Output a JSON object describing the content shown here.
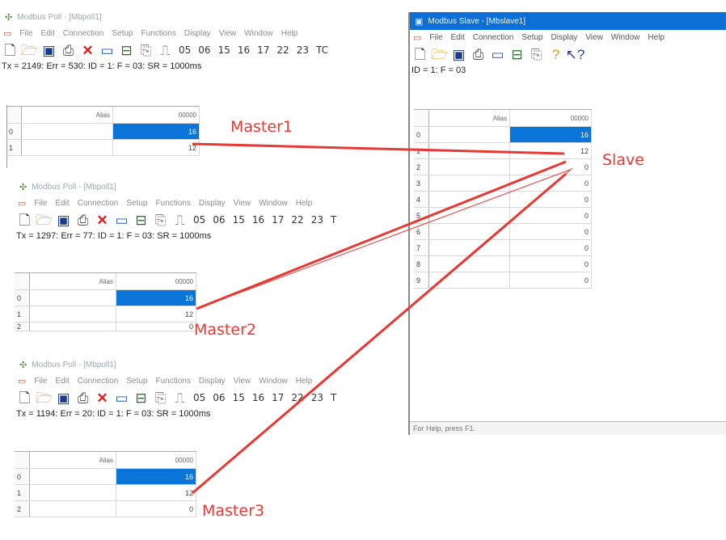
{
  "master1": {
    "title": "Modbus Poll - [Mbpoll1]",
    "menu": [
      "File",
      "Edit",
      "Connection",
      "Setup",
      "Functions",
      "Display",
      "View",
      "Window",
      "Help"
    ],
    "function_buttons": [
      "05",
      "06",
      "15",
      "16",
      "17",
      "22",
      "23",
      "TC"
    ],
    "status": "Tx = 2149: Err = 530: ID = 1: F = 03: SR = 1000ms",
    "grid": {
      "alias_header": "Alias",
      "value_header": "00000",
      "rows": [
        {
          "index": "0",
          "value": "16"
        },
        {
          "index": "1",
          "value": "12"
        }
      ]
    }
  },
  "master2": {
    "title": "Modbus Poll - [Mbpoll1]",
    "menu": [
      "File",
      "Edit",
      "Connection",
      "Setup",
      "Functions",
      "Display",
      "View",
      "Window",
      "Help"
    ],
    "function_buttons": [
      "05",
      "06",
      "15",
      "16",
      "17",
      "22",
      "23",
      "T"
    ],
    "status": "Tx = 1297: Err = 77: ID = 1: F = 03: SR = 1000ms",
    "grid": {
      "alias_header": "Alias",
      "value_header": "00000",
      "rows": [
        {
          "index": "0",
          "value": "16"
        },
        {
          "index": "1",
          "value": "12"
        },
        {
          "index": "2",
          "value": "0"
        }
      ]
    }
  },
  "master3": {
    "title": "Modbus Poll - [Mbpoll1]",
    "menu": [
      "File",
      "Edit",
      "Connection",
      "Setup",
      "Functions",
      "Display",
      "View",
      "Window",
      "Help"
    ],
    "function_buttons": [
      "05",
      "06",
      "15",
      "16",
      "17",
      "22",
      "23",
      "T"
    ],
    "status": "Tx = 1194: Err = 20: ID = 1: F = 03: SR = 1000ms",
    "grid": {
      "alias_header": "Alias",
      "value_header": "00000",
      "rows": [
        {
          "index": "0",
          "value": "16"
        },
        {
          "index": "1",
          "value": "12"
        },
        {
          "index": "2",
          "value": "0"
        }
      ]
    }
  },
  "slave": {
    "title": "Modbus Slave - [Mbslave1]",
    "menu": [
      "File",
      "Edit",
      "Connection",
      "Setup",
      "Display",
      "View",
      "Window",
      "Help"
    ],
    "status": "ID = 1: F = 03",
    "footer": "For Help, press F1.",
    "grid": {
      "alias_header": "Alias",
      "value_header": "00000",
      "rows": [
        {
          "index": "0",
          "value": "16"
        },
        {
          "index": "1",
          "value": "12"
        },
        {
          "index": "2",
          "value": "0"
        },
        {
          "index": "3",
          "value": "0"
        },
        {
          "index": "4",
          "value": "0"
        },
        {
          "index": "5",
          "value": "0"
        },
        {
          "index": "6",
          "value": "0"
        },
        {
          "index": "7",
          "value": "0"
        },
        {
          "index": "8",
          "value": "0"
        },
        {
          "index": "9",
          "value": "0"
        }
      ]
    }
  },
  "annotations": {
    "master1": "Master1",
    "master2": "Master2",
    "master3": "Master3",
    "slave": "Slave",
    "line_color": "#e53935"
  }
}
